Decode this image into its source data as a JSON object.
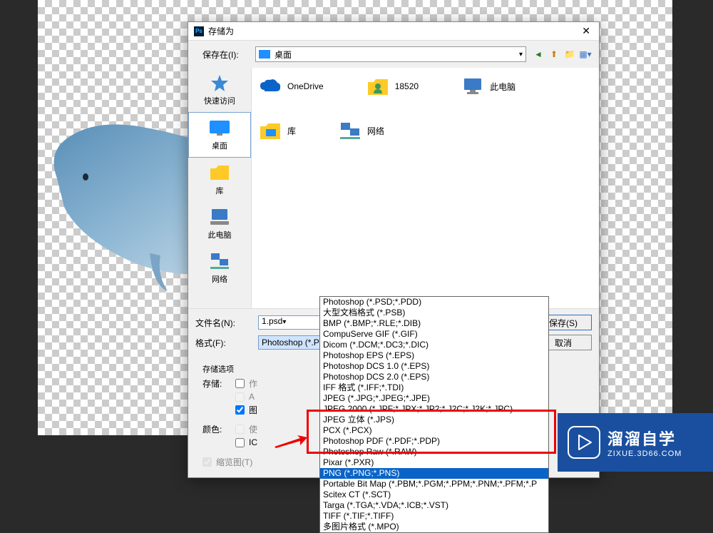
{
  "dialog": {
    "title": "存储为",
    "savein_label": "保存在(I):",
    "savein_value": "桌面",
    "filename_label": "文件名(N):",
    "filename_value": "1.psd",
    "format_label": "格式(F):",
    "format_value": "Photoshop (*.PSD;*.PDD)",
    "save_btn": "保存(S)",
    "cancel_btn": "取消"
  },
  "sidebar": {
    "items": [
      {
        "label": "快速访问",
        "icon": "star"
      },
      {
        "label": "桌面",
        "icon": "desktop"
      },
      {
        "label": "库",
        "icon": "folder"
      },
      {
        "label": "此电脑",
        "icon": "pc"
      },
      {
        "label": "网络",
        "icon": "network"
      }
    ]
  },
  "files": [
    {
      "label": "OneDrive",
      "icon": "onedrive"
    },
    {
      "label": "18520",
      "icon": "user"
    },
    {
      "label": "此电脑",
      "icon": "pc"
    },
    {
      "label": "库",
      "icon": "library"
    },
    {
      "label": "网络",
      "icon": "network"
    }
  ],
  "storage": {
    "section": "存储选项",
    "sub": "存储:",
    "opt1": "作",
    "opt2": "A",
    "opt3": "图",
    "color_label": "颜色:",
    "coloropt1": "使",
    "coloropt2": "IC",
    "thumb": "缩览图(T)"
  },
  "format_options": [
    "Photoshop (*.PSD;*.PDD)",
    "大型文档格式 (*.PSB)",
    "BMP (*.BMP;*.RLE;*.DIB)",
    "CompuServe GIF (*.GIF)",
    "Dicom (*.DCM;*.DC3;*.DIC)",
    "Photoshop EPS (*.EPS)",
    "Photoshop DCS 1.0 (*.EPS)",
    "Photoshop DCS 2.0 (*.EPS)",
    "IFF 格式 (*.IFF;*.TDI)",
    "JPEG (*.JPG;*.JPEG;*.JPE)",
    "JPEG 2000 (*.JPF;*.JPX;*.JP2;*.J2C;*.J2K;*.JPC)",
    "JPEG 立体 (*.JPS)",
    "PCX (*.PCX)",
    "Photoshop PDF (*.PDF;*.PDP)",
    "Photoshop Raw (*.RAW)",
    "Pixar (*.PXR)",
    "PNG (*.PNG;*.PNS)",
    "Portable Bit Map (*.PBM;*.PGM;*.PPM;*.PNM;*.PFM;*.P",
    "Scitex CT (*.SCT)",
    "Targa (*.TGA;*.VDA;*.ICB;*.VST)",
    "TIFF (*.TIF;*.TIFF)",
    "多图片格式 (*.MPO)"
  ],
  "selected_format_index": 16,
  "watermark": {
    "brand": "溜溜自学",
    "url": "ZIXUE.3D66.COM"
  }
}
